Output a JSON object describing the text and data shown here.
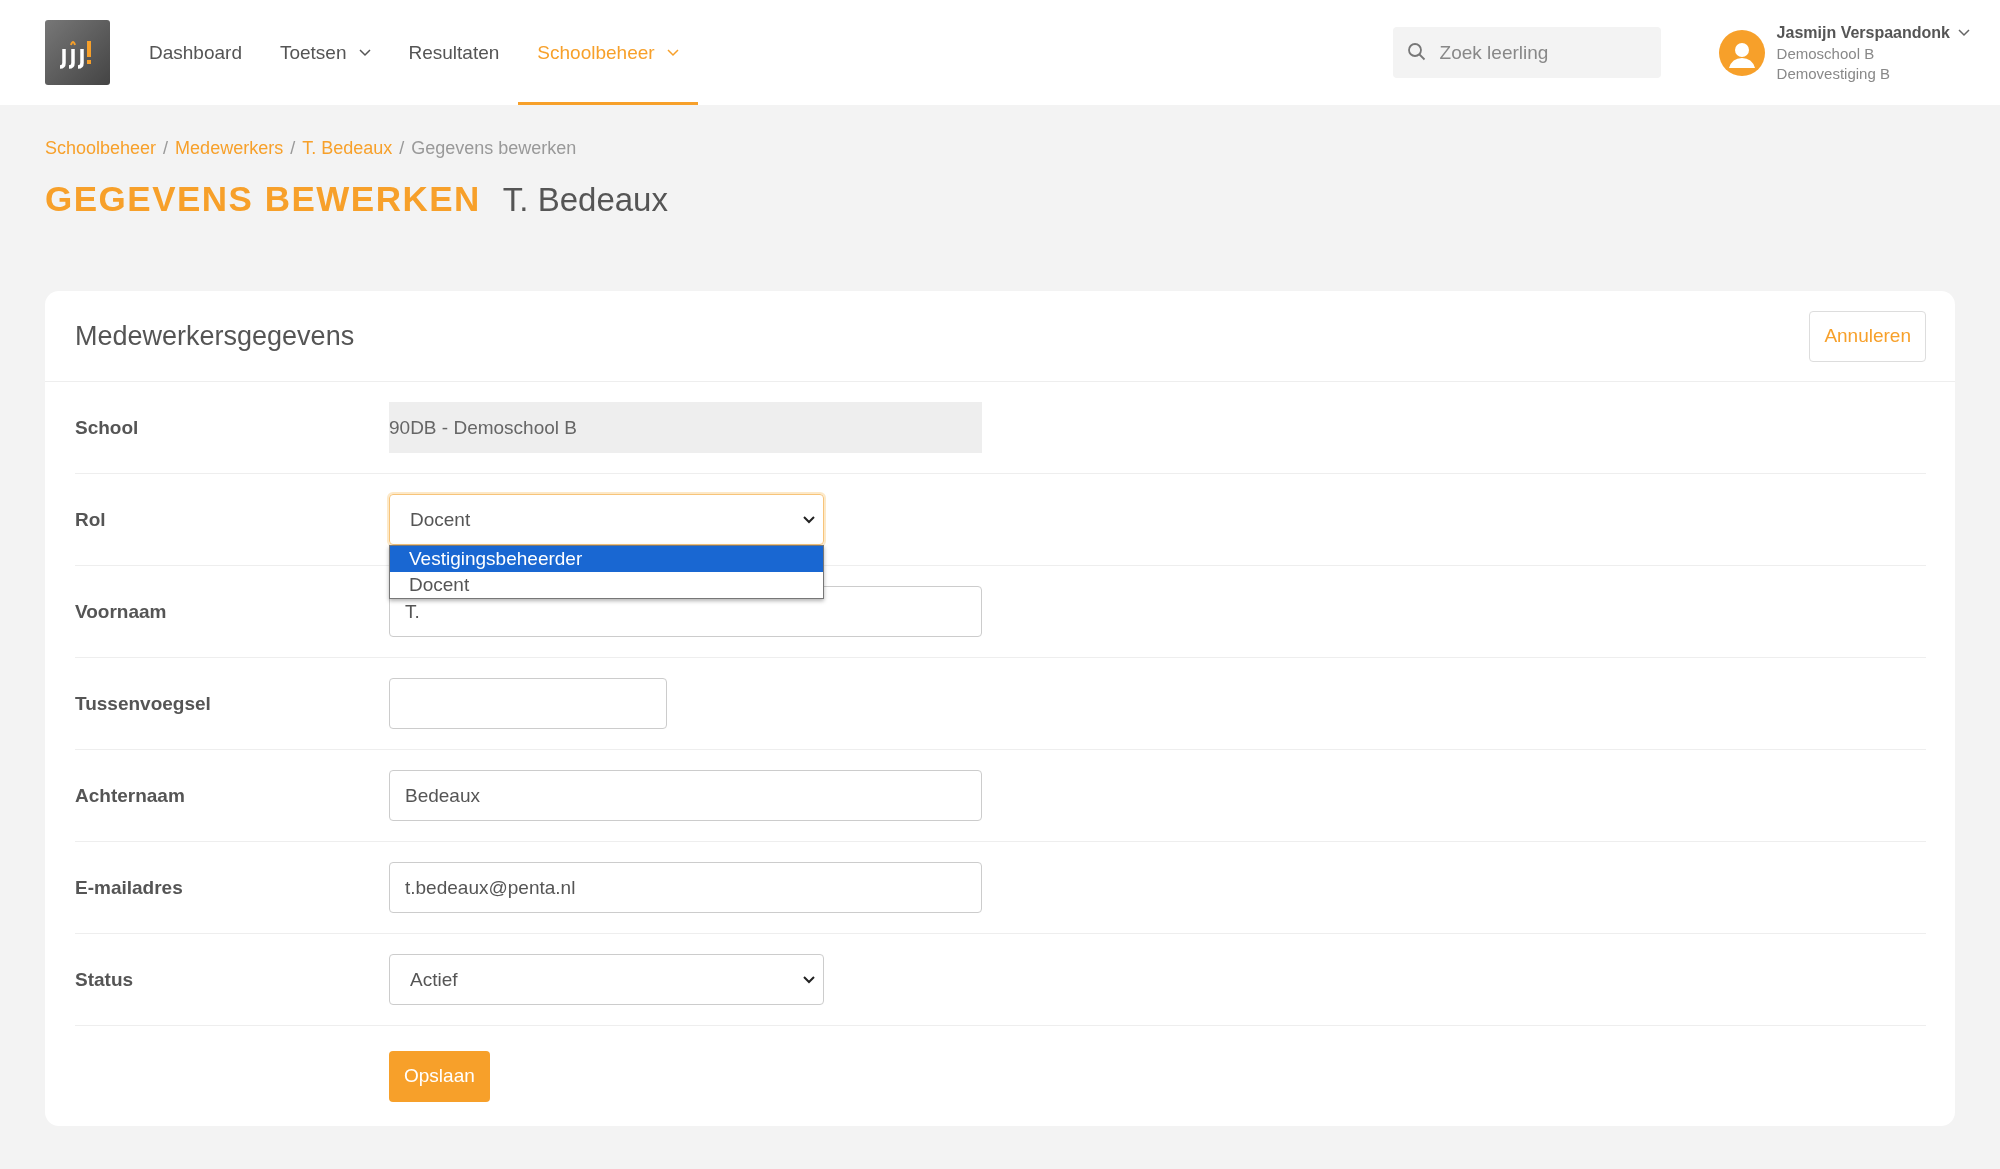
{
  "nav": {
    "items": [
      {
        "label": "Dashboard",
        "has_menu": false,
        "selected": false
      },
      {
        "label": "Toetsen",
        "has_menu": true,
        "selected": false
      },
      {
        "label": "Resultaten",
        "has_menu": false,
        "selected": false
      },
      {
        "label": "Schoolbeheer",
        "has_menu": true,
        "selected": true
      }
    ],
    "search": {
      "placeholder": "Zoek leerling"
    },
    "user": {
      "name": "Jasmijn Verspaandonk",
      "school": "Demoschool B",
      "branch": "Demovestiging B"
    }
  },
  "breadcrumb_separator": "/",
  "breadcrumb": [
    {
      "label": "Schoolbeheer",
      "link": true
    },
    {
      "label": "Medewerkers",
      "link": true
    },
    {
      "label": "T. Bedeaux",
      "link": true
    },
    {
      "label": "Gegevens bewerken",
      "link": false
    }
  ],
  "page_title": "GEGEVENS BEWERKEN",
  "page_subtitle": "T. Bedeaux",
  "card": {
    "title": "Medewerkersgegevens",
    "cancel_button": "Annuleren",
    "fields": [
      {
        "label": "School",
        "kind": "readonly",
        "value": "90DB - Demoschool B"
      },
      {
        "label": "Rol",
        "kind": "select",
        "value": "Docent",
        "focused": true,
        "open": true,
        "options": [
          {
            "label": "Vestigingsbeheerder",
            "highlighted": true
          },
          {
            "label": "Docent",
            "highlighted": false
          }
        ]
      },
      {
        "label": "Voornaam",
        "kind": "text",
        "value": "T."
      },
      {
        "label": "Tussenvoegsel",
        "kind": "short"
      },
      {
        "label": "Achternaam",
        "kind": "text",
        "value": "Bedeaux"
      },
      {
        "label": "E-mailadres",
        "kind": "text",
        "value": "t.bedeaux@penta.nl"
      },
      {
        "label": "Status",
        "kind": "select",
        "value": "Actief",
        "focused": false,
        "open": false
      }
    ],
    "save_button": "Opslaan"
  }
}
